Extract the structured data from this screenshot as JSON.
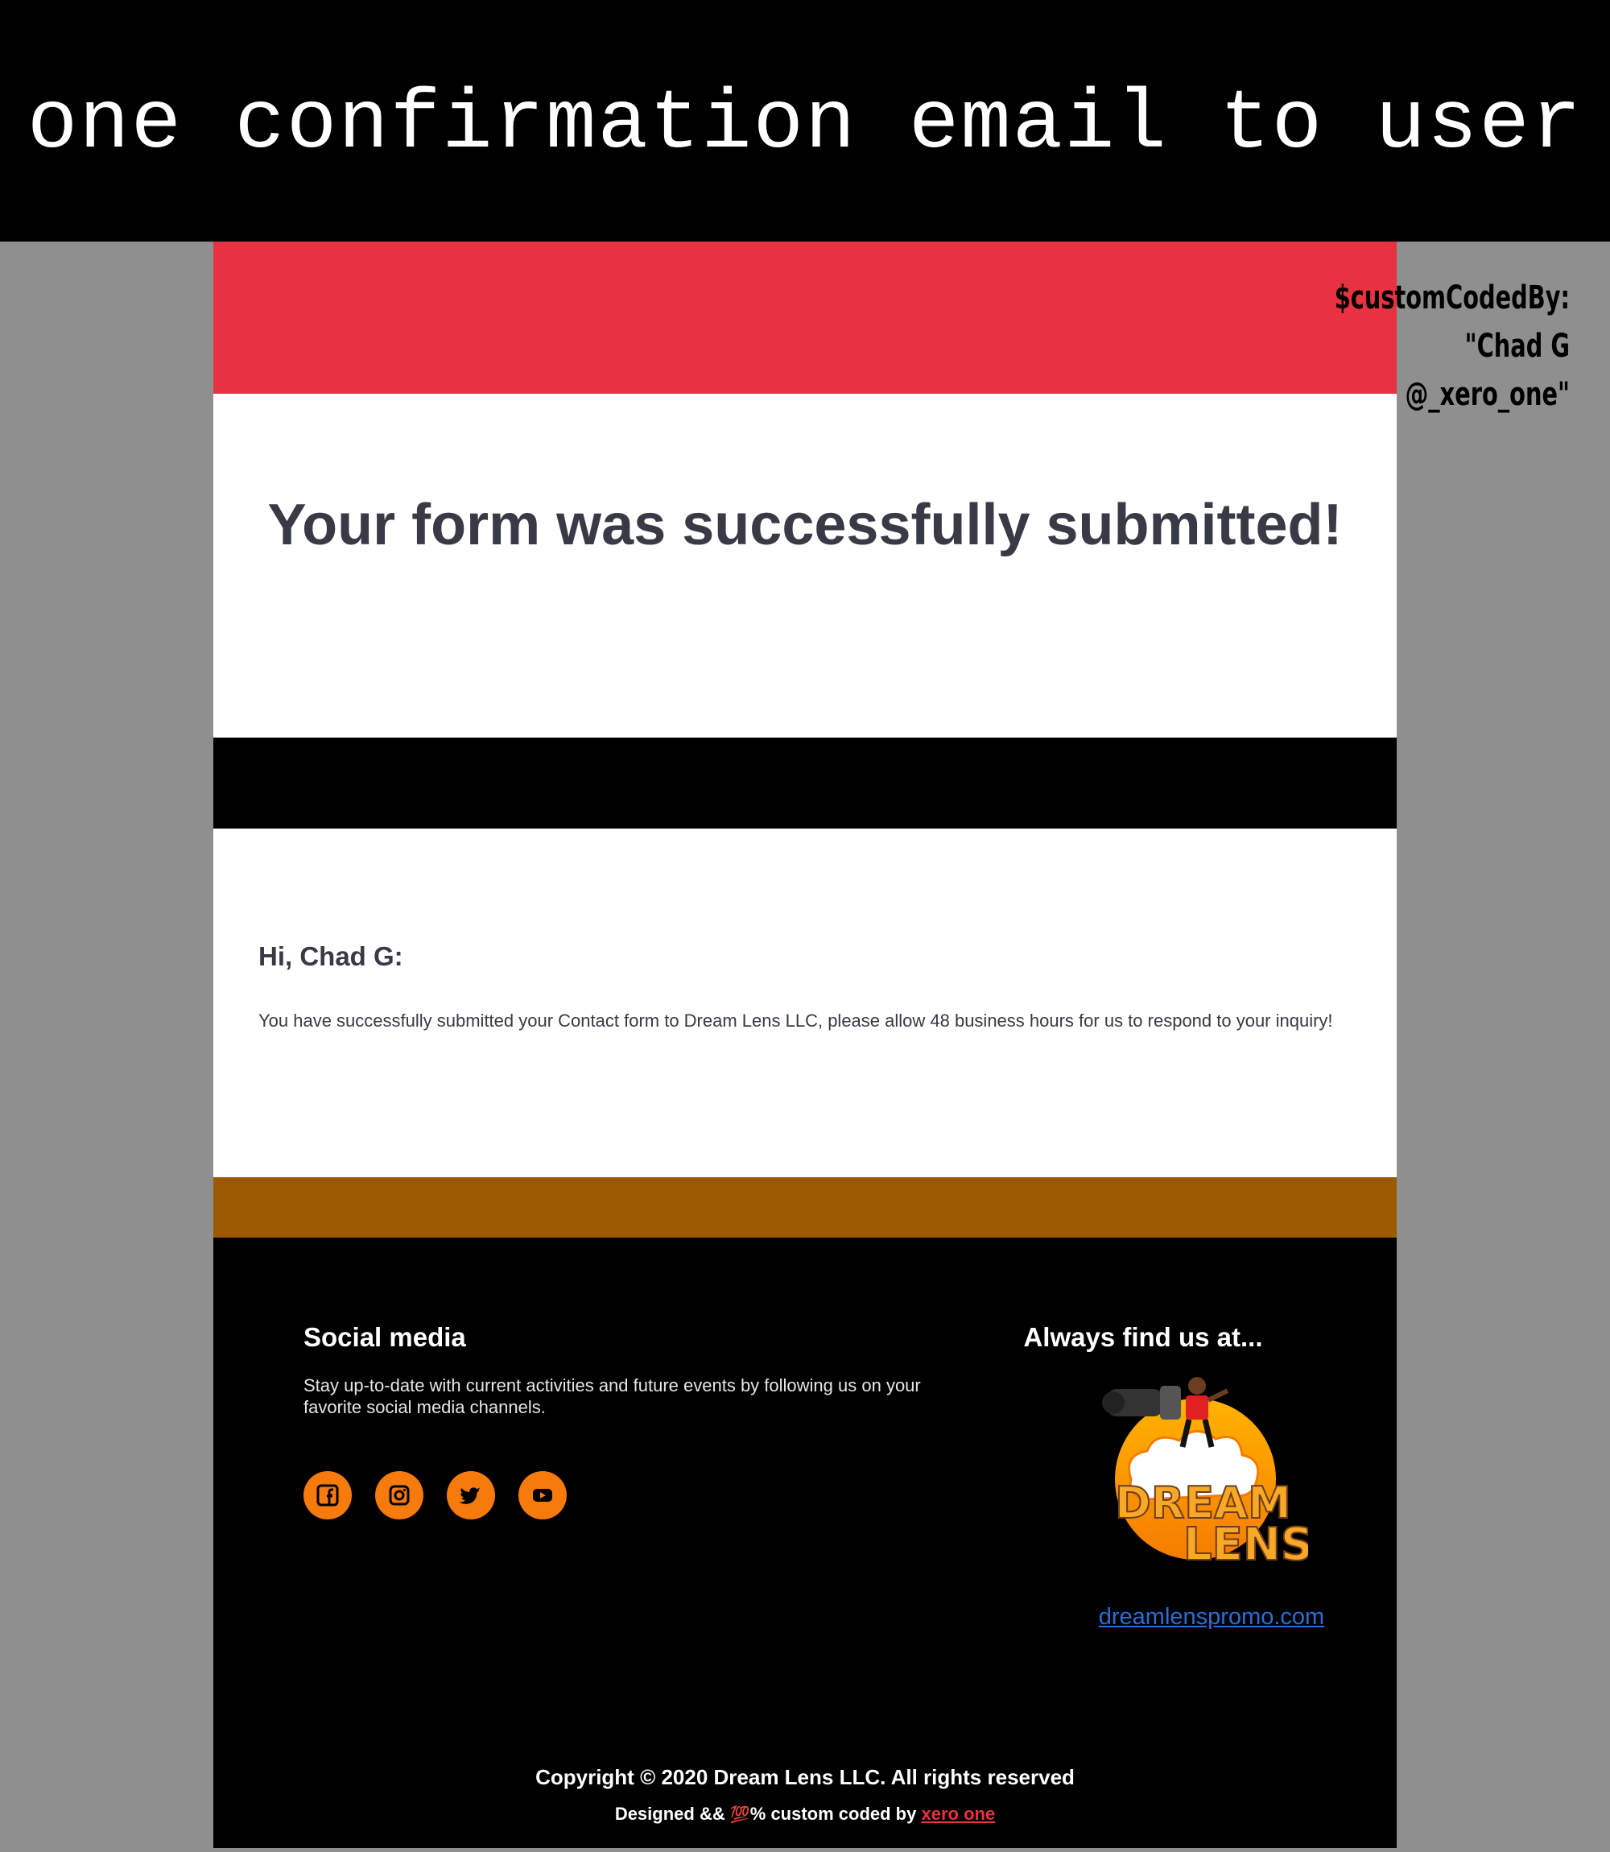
{
  "banner": {
    "caption": "one confirmation email to user"
  },
  "credit": {
    "line1": "$customCodedBy:",
    "line2": "\"Chad G",
    "line3": "@_xero_one\""
  },
  "email": {
    "headline": "Your form was successfully submitted!",
    "greeting": "Hi, Chad G:",
    "body": "You have successfully submitted your Contact form to Dream Lens LLC, please allow 48 business hours for us to respond to your inquiry!"
  },
  "footer": {
    "social_title": "Social media",
    "social_desc": "Stay up-to-date with current activities and future events by following us on your favorite social media channels.",
    "social_icons": [
      "facebook-icon",
      "instagram-icon",
      "twitter-icon",
      "youtube-icon"
    ],
    "find_title": "Always find us at...",
    "logo_text": [
      "DREAM",
      "LENS"
    ],
    "site_link": "dreamlenspromo.com",
    "copyright": "Copyright © 2020 Dream Lens LLC. All rights reserved",
    "designed_prefix": "Designed &&",
    "designed_emoji": "💯",
    "designed_mid": "% custom coded by",
    "designed_link": "xero one"
  },
  "colors": {
    "red": "#e83242",
    "brown": "#9b5900",
    "orange": "#f77a0c",
    "gray_bg": "#8f8f8f",
    "link_blue": "#2b6cd6"
  }
}
